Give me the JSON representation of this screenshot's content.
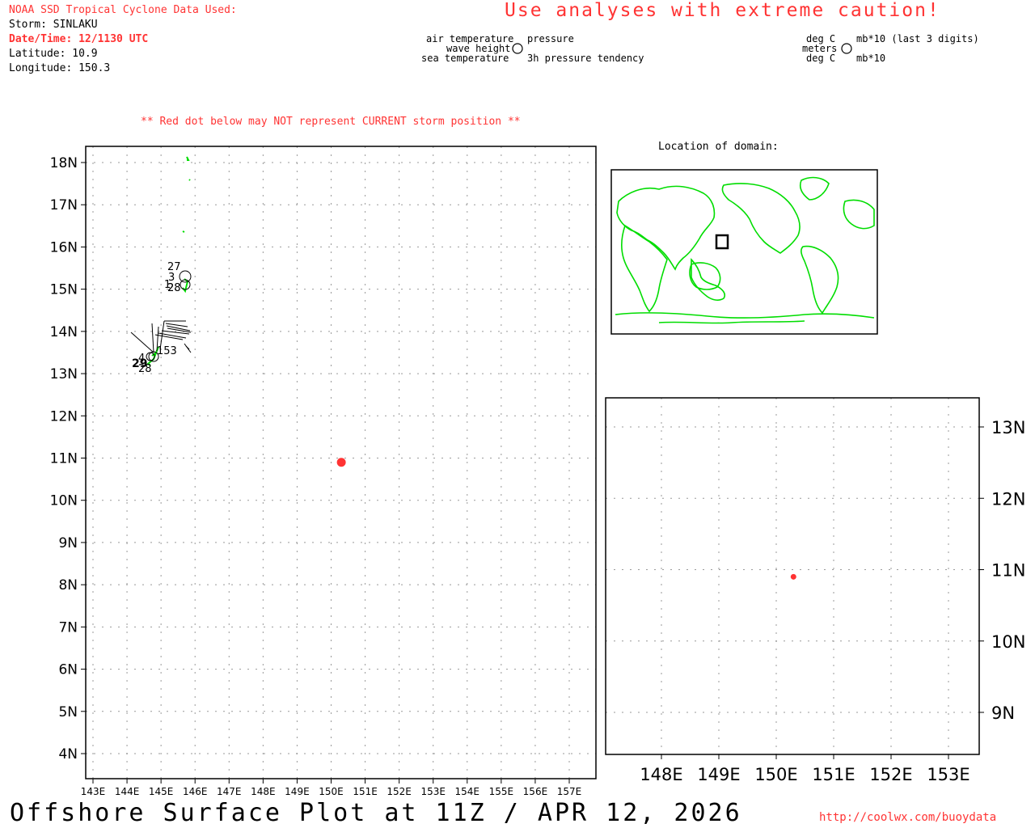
{
  "header": {
    "source": "NOAA SSD Tropical Cyclone Data Used:",
    "storm": "Storm: SINLAKU",
    "datetime": "Date/Time: 12/1130 UTC",
    "latitude": "Latitude: 10.9",
    "longitude": "Longitude: 150.3"
  },
  "warning": "Use analyses with extreme caution!",
  "legend_left": {
    "air_temp": "air temperature",
    "wave_height": "wave height",
    "sea_temp": "sea temperature",
    "pressure": "pressure",
    "pressure_tendency": "3h pressure tendency"
  },
  "legend_right": {
    "deg_c_top": "deg C",
    "meters": "meters",
    "deg_c_bottom": "deg C",
    "mb_top": "mb*10 (last 3 digits)",
    "mb_bottom": "mb*10"
  },
  "red_dot_note": "** Red dot below may NOT represent CURRENT storm position **",
  "location_of_domain": "Location of domain:",
  "main_map": {
    "lat_labels": [
      "18N",
      "17N",
      "16N",
      "15N",
      "14N",
      "13N",
      "12N",
      "11N",
      "10N",
      "9N",
      "8N",
      "7N",
      "6N",
      "5N",
      "4N"
    ],
    "lon_labels": [
      "143E",
      "144E",
      "145E",
      "146E",
      "147E",
      "148E",
      "149E",
      "150E",
      "151E",
      "152E",
      "153E",
      "154E",
      "155E",
      "156E",
      "157E"
    ],
    "storm_position": {
      "lat": 10.9,
      "lon": 150.3
    },
    "station_labels": [
      "27",
      "3",
      "1",
      "2",
      "28",
      "4",
      "29",
      "28",
      "153"
    ]
  },
  "zoom_map": {
    "lat_labels": [
      "13N",
      "12N",
      "11N",
      "10N",
      "9N"
    ],
    "lon_labels": [
      "148E",
      "149E",
      "150E",
      "151E",
      "152E",
      "153E"
    ]
  },
  "colors": {
    "storm": "#ff3333",
    "coast": "#00dd00",
    "text": "#000000"
  },
  "footer": {
    "title": "Offshore Surface Plot at 11Z / APR 12, 2026",
    "url": "http://coolwx.com/buoydata"
  }
}
